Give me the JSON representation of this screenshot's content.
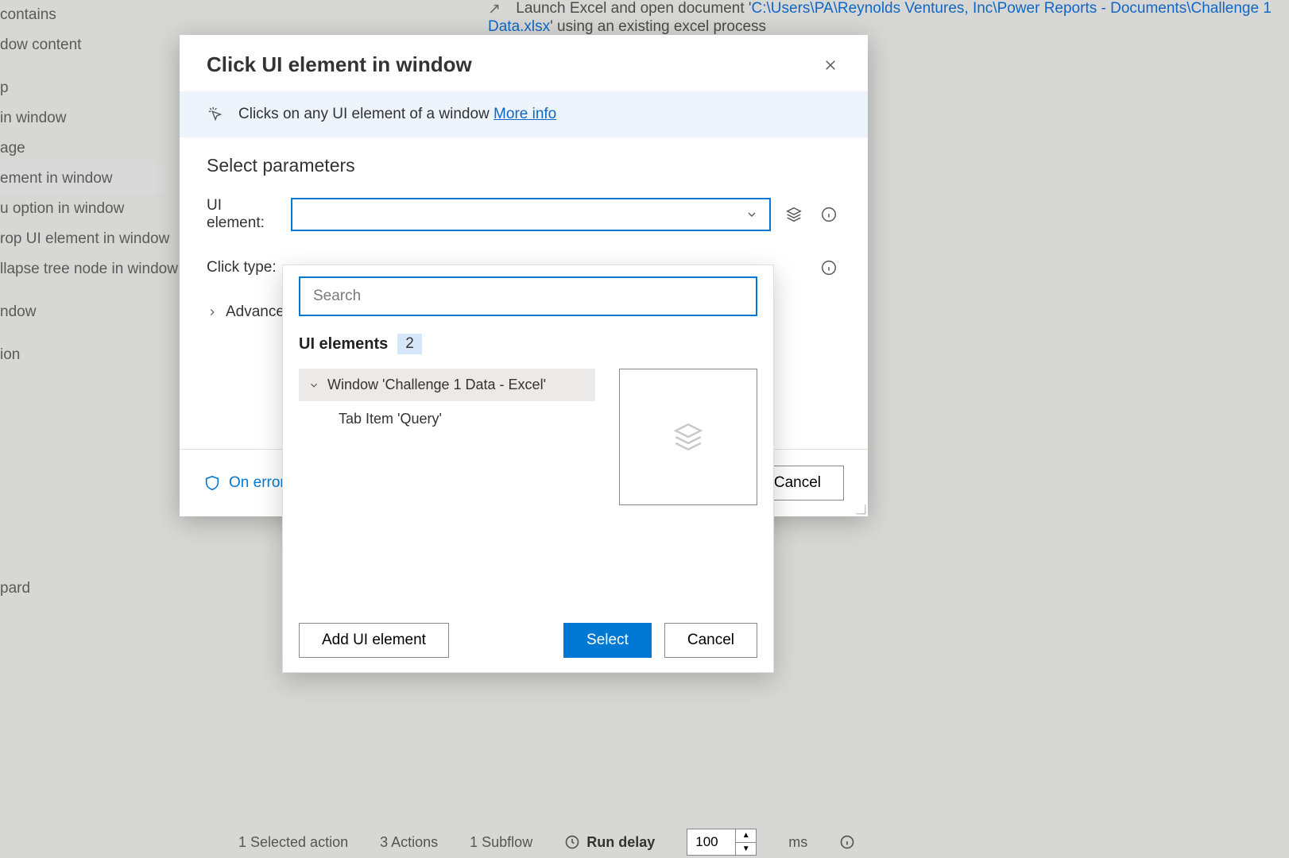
{
  "backdrop": {
    "left_items": [
      "contains",
      "dow content",
      " ",
      "p",
      "in window",
      "age",
      "ement in window",
      "u option in window",
      "rop UI element in window",
      "llapse tree node in window",
      " ",
      "ndow",
      " ",
      "ion"
    ],
    "left_selected_index": 6,
    "left_lower": "pard",
    "top_text_prefix": "Launch Excel and open document '",
    "top_path": "C:\\Users\\PA\\Reynolds Ventures, Inc\\Power Reports - Documents\\Challenge 1 Data.xlsx",
    "top_text_suffix": "' using an existing excel process",
    "status": {
      "selected": "1 Selected action",
      "actions": "3 Actions",
      "subflows": "1 Subflow",
      "run_delay_label": "Run delay",
      "run_delay_value": "100",
      "ms": "ms"
    }
  },
  "modal": {
    "title": "Click UI element in window",
    "banner_text": "Clicks on any UI element of a window",
    "banner_link": "More info",
    "params_title": "Select parameters",
    "ui_element_label": "UI element:",
    "click_type_label": "Click type:",
    "advanced_label": "Advanced",
    "on_error_label": "On error",
    "cancel_label": "Cancel"
  },
  "popover": {
    "search_placeholder": "Search",
    "heading": "UI elements",
    "count": "2",
    "tree_root": "Window 'Challenge 1 Data - Excel'",
    "tree_child": "Tab Item 'Query'",
    "add_btn": "Add UI element",
    "select_btn": "Select",
    "cancel_btn": "Cancel"
  }
}
